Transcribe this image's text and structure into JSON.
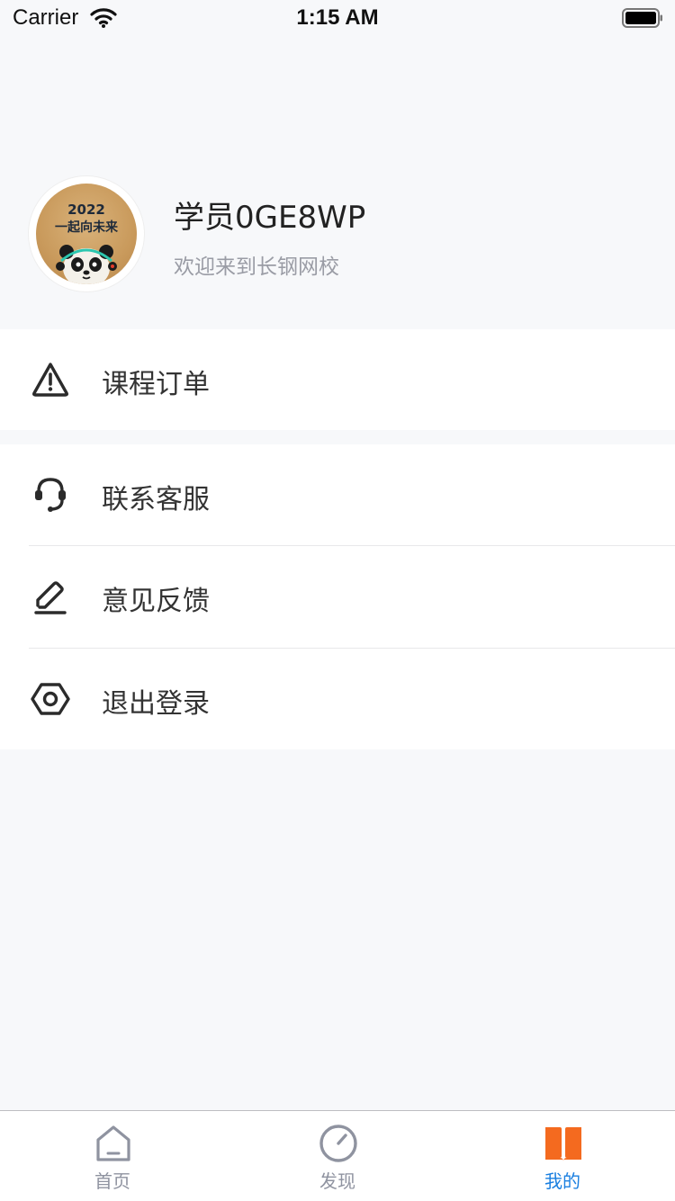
{
  "status_bar": {
    "carrier": "Carrier",
    "time": "1:15 AM"
  },
  "profile": {
    "username": "学员0GE8WP",
    "welcome": "欢迎来到长钢网校",
    "avatar": {
      "year": "2022",
      "slogan": "一起向未来"
    }
  },
  "menu": {
    "orders": {
      "label": "课程订单",
      "icon": "warning-triangle-icon"
    },
    "items": [
      {
        "label": "联系客服",
        "icon": "headset-icon"
      },
      {
        "label": "意见反馈",
        "icon": "pencil-icon"
      },
      {
        "label": "退出登录",
        "icon": "hexagon-nut-icon"
      }
    ]
  },
  "tabbar": {
    "tabs": [
      {
        "label": "首页",
        "icon": "home-icon",
        "active": false
      },
      {
        "label": "发现",
        "icon": "compass-icon",
        "active": false
      },
      {
        "label": "我的",
        "icon": "book-icon",
        "active": true
      }
    ]
  },
  "colors": {
    "accent": "#1a7fe0",
    "book_orange": "#f46a1f",
    "inactive": "#8f93a0",
    "background": "#f7f8fa"
  }
}
